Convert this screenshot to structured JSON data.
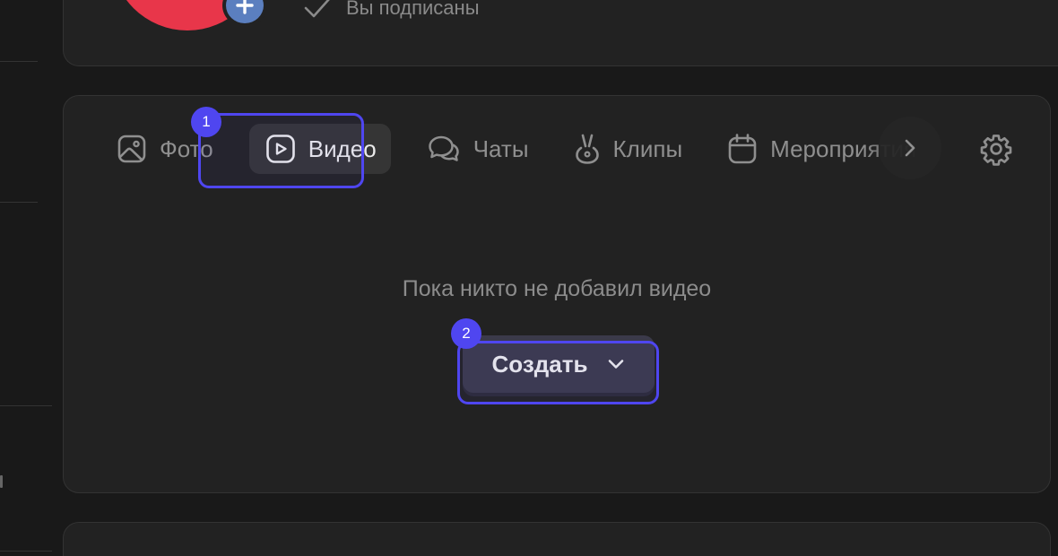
{
  "profile": {
    "subscribed_label": "Вы подписаны",
    "avatar_color": "#e8364a",
    "add_button_color": "#5b7fbf"
  },
  "tabs": [
    {
      "label": "Фото",
      "icon": "image-icon",
      "active": false
    },
    {
      "label": "Видео",
      "icon": "play-icon",
      "active": true
    },
    {
      "label": "Чаты",
      "icon": "chat-icon",
      "active": false
    },
    {
      "label": "Клипы",
      "icon": "clips-icon",
      "active": false
    },
    {
      "label": "Мероприятия",
      "icon": "calendar-icon",
      "active": false
    }
  ],
  "main": {
    "empty_text": "Пока никто не добавил видео",
    "create_label": "Создать"
  },
  "annotations": [
    {
      "label": "1",
      "target": "tab-video"
    },
    {
      "label": "2",
      "target": "create-button"
    }
  ],
  "colors": {
    "background": "#191919",
    "card": "#222222",
    "accent": "#4f46f0",
    "create_button": "#3b3a4a"
  }
}
